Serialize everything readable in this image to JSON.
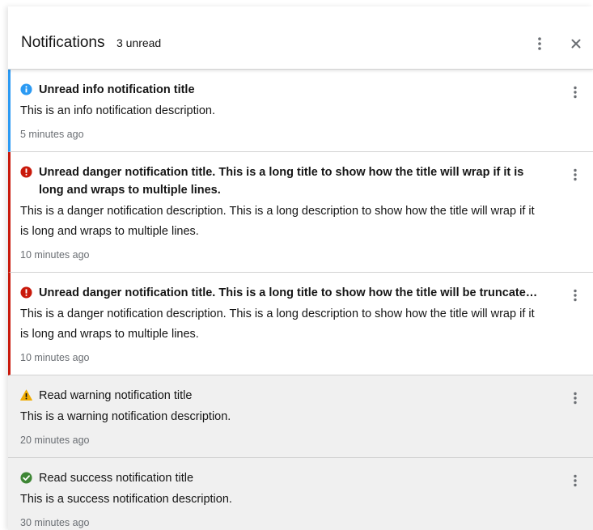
{
  "header": {
    "title": "Notifications",
    "count": "3 unread",
    "kebab_icon": "kebab-icon",
    "close_icon": "close-icon"
  },
  "colors": {
    "info": "#2b9af3",
    "danger": "#c9190b",
    "warning": "#f0ab00",
    "success": "#3e8635",
    "read_bg": "#f0f0f0",
    "time_text": "#6a6e73"
  },
  "notifications": [
    {
      "status": "info",
      "icon": "info-circle-icon",
      "read": false,
      "title": "Unread info notification title",
      "description": "This is an info notification description.",
      "time": "5 minutes ago"
    },
    {
      "status": "danger",
      "icon": "exclamation-circle-icon",
      "read": false,
      "title": "Unread danger notification title. This is a long title to show how the title will wrap if it is long and wraps to multiple lines.",
      "description": "This is a danger notification description. This is a long description to show how the title will wrap if it is long and wraps to multiple lines.",
      "time": "10 minutes ago"
    },
    {
      "status": "danger",
      "icon": "exclamation-circle-icon",
      "read": false,
      "title": "Unread danger notification title. This is a long title to show how the title will be truncated if it is long and will be shown in a single line.",
      "description": "This is a danger notification description. This is a long description to show how the title will wrap if it is long and wraps to multiple lines.",
      "time": "10 minutes ago"
    },
    {
      "status": "warning",
      "icon": "warning-triangle-icon",
      "read": true,
      "title": "Read warning notification title",
      "description": "This is a warning notification description.",
      "time": "20 minutes ago"
    },
    {
      "status": "success",
      "icon": "check-circle-icon",
      "read": true,
      "title": "Read success notification title",
      "description": "This is a success notification description.",
      "time": "30 minutes ago"
    }
  ]
}
